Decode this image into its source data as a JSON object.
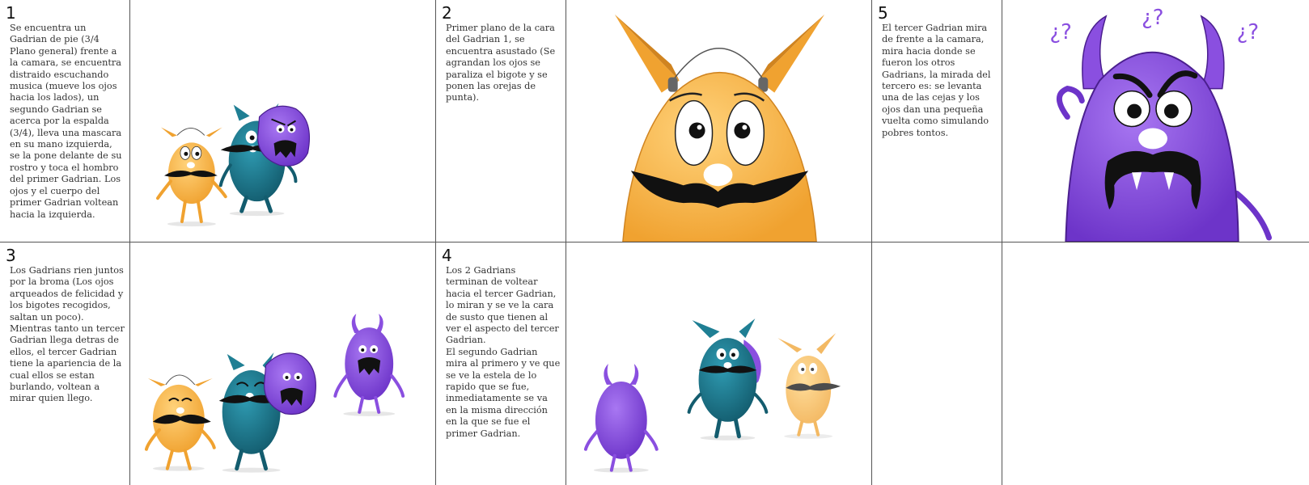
{
  "colors": {
    "orange": "#f7b24a",
    "orange_dark": "#e0962a",
    "teal": "#1f7f94",
    "teal_dark": "#145e70",
    "purple": "#8a4fe0",
    "purple_dark": "#6a32c2",
    "mustache": "#111111",
    "grid_line": "#555555"
  },
  "panels": [
    {
      "number": "1",
      "text": "Se encuentra un Gadrian de pie (3/4 Plano general) frente a la camara, se encuentra distraido escuchando musica (mueve los ojos hacia los lados), un segundo Gadrian se acerca por la espalda (3/4), lleva una mascara en su mano izquierda, se la pone delante de su rostro y toca el hombro del primer Gadrian. Los ojos y el cuerpo del primer Gadrian voltean hacia la izquierda."
    },
    {
      "number": "2",
      "text": "Primer plano de la cara del Gadrian 1, se encuentra asustado (Se agrandan los ojos se paraliza el bigote y se ponen las orejas de punta)."
    },
    {
      "number": "5",
      "text": "El tercer Gadrian mira de frente a la camara, mira hacia donde se fueron los otros Gadrians, la mirada del tercero es: se levanta una de las cejas y los ojos dan una pequeña vuelta como simulando pobres tontos.",
      "marks": "¿?"
    },
    {
      "number": "3",
      "text": "Los Gadrians rien juntos por la broma (Los ojos arqueados de felicidad y los bigotes recogidos, saltan un poco). Mientras tanto un tercer Gadrian llega detras de ellos, el tercer Gadrian tiene la apariencia de la cual ellos se estan burlando, voltean a mirar quien llego."
    },
    {
      "number": "4",
      "text": "Los 2 Gadrians terminan de voltear hacia el tercer Gadrian, lo miran y se ve la cara de susto que tienen al ver el aspecto del tercer Gadrian.\nEl segundo Gadrian mira al primero y ve que se ve la estela de lo rapido que se fue, inmediatamente se va en la misma dirección en la que se fue el primer Gadrian."
    }
  ]
}
